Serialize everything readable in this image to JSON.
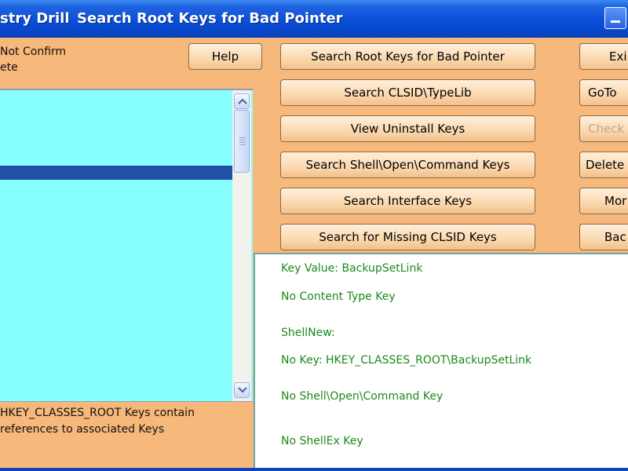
{
  "window": {
    "title_left": "stry Drill",
    "title_main": "Search Root Keys for Bad Pointer"
  },
  "options": {
    "line1": "Not Confirm",
    "line2": "ete"
  },
  "buttons": {
    "help": "Help",
    "search_root_keys": "Search Root Keys for Bad Pointer",
    "search_clsid": "Search CLSID\\TypeLib",
    "view_uninstall": "View Uninstall Keys",
    "search_shell": "Search Shell\\Open\\Command Keys",
    "search_interface": "Search Interface Keys",
    "search_missing_clsid": "Search for Missing CLSID Keys",
    "exit": "Exi",
    "goto": "GoTo",
    "check": "Check",
    "delete": "Delete",
    "more": "Mor",
    "back": "Bac"
  },
  "status": {
    "line1": "HKEY_CLASSES_ROOT Keys contain",
    "line2": "references to associated Keys"
  },
  "detail": {
    "lines": [
      "Key Value: BackupSetLink",
      "No Content Type Key",
      "ShellNew:",
      "No Key: HKEY_CLASSES_ROOT\\BackupSetLink",
      "No Shell\\Open\\Command Key",
      "No ShellEx Key"
    ]
  },
  "colors": {
    "window_bg": "#F7B87B",
    "titlebar": "#0A4FD8",
    "listbox_bg": "#88FFFF",
    "selection": "#2050A8",
    "detail_text": "#1A8A1A"
  }
}
